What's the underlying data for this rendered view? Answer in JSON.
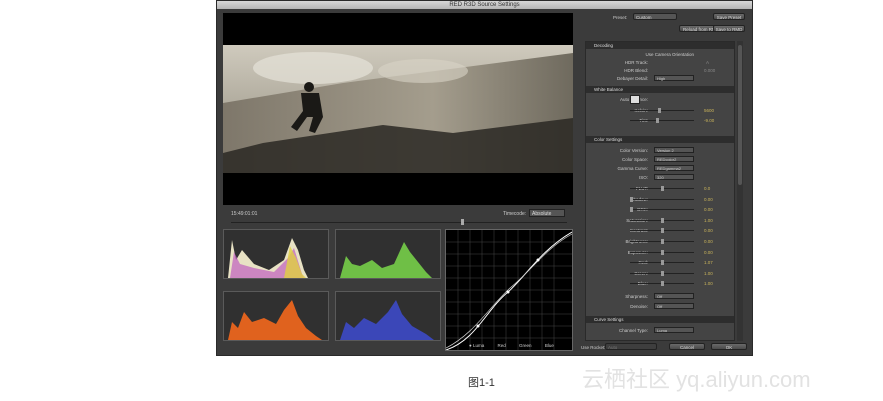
{
  "window": {
    "title": "RED R3D Source Settings"
  },
  "viewer": {
    "timecode": "15:49:01:01",
    "timecode_label": "Timecode:",
    "timecode_mode": "Absolute"
  },
  "curves": {
    "channels": [
      "Luma",
      "Red",
      "Green",
      "Blue"
    ]
  },
  "right": {
    "preset_label": "Preset:",
    "preset_value": "Custom",
    "save_preset": "Save Preset",
    "reload": "Reload from RMD",
    "save_rmd": "Save to RMD",
    "sections": {
      "decoding": "Decoding",
      "white_balance": "White Balance",
      "color_settings": "Color Settings",
      "curve_settings": "Curve Settings"
    },
    "decoding": {
      "use_camera": "Use Camera Orientation",
      "hdr_track": "HDR Track:",
      "hdr_track_val": "A",
      "hdr_blend": "HDR Blend:",
      "hdr_blend_val": "0.000",
      "debayer": "Debayer Detail:",
      "debayer_val": "High"
    },
    "white_balance": {
      "auto": "Auto Balance:",
      "kelvin": "Kelvin:",
      "kelvin_val": "5600",
      "tint": "Tint:",
      "tint_val": "-9.00"
    },
    "color": {
      "version": "Color Version:",
      "version_val": "Version 2",
      "space": "Color Space:",
      "space_val": "REDcolor2",
      "gamma": "Gamma Curve:",
      "gamma_val": "REDgamma2",
      "iso": "ISO:",
      "iso_val": "320",
      "sliders": [
        {
          "label": "FLUT:",
          "value": "0.0",
          "pos": 0.5
        },
        {
          "label": "Shadow:",
          "value": "0.00",
          "pos": 0.0
        },
        {
          "label": "DRX:",
          "value": "0.00",
          "pos": 0.0
        },
        {
          "label": "Saturation:",
          "value": "1.00",
          "pos": 0.5
        },
        {
          "label": "Contrast:",
          "value": "0.00",
          "pos": 0.5
        },
        {
          "label": "Brightness:",
          "value": "0.00",
          "pos": 0.5
        },
        {
          "label": "Exposure:",
          "value": "0.00",
          "pos": 0.5
        },
        {
          "label": "Red:",
          "value": "1.07",
          "pos": 0.5
        },
        {
          "label": "Green:",
          "value": "1.00",
          "pos": 0.5
        },
        {
          "label": "Blue:",
          "value": "1.00",
          "pos": 0.5
        }
      ],
      "sharpness": "Sharpness:",
      "sharpness_val": "Off",
      "denoise": "Denoise:",
      "denoise_val": "Off"
    },
    "curve": {
      "channel_type": "Channel Type:",
      "channel_val": "Luma"
    },
    "bottom": {
      "use_rocket": "Use Rocket:",
      "rocket_val": "Auto",
      "cancel": "Cancel",
      "ok": "OK"
    }
  },
  "caption": "图1-1",
  "watermark": "云栖社区 yq.aliyun.com",
  "colors": {
    "window_bg": "#3b3b3b",
    "value_gold": "#c9b35a"
  }
}
